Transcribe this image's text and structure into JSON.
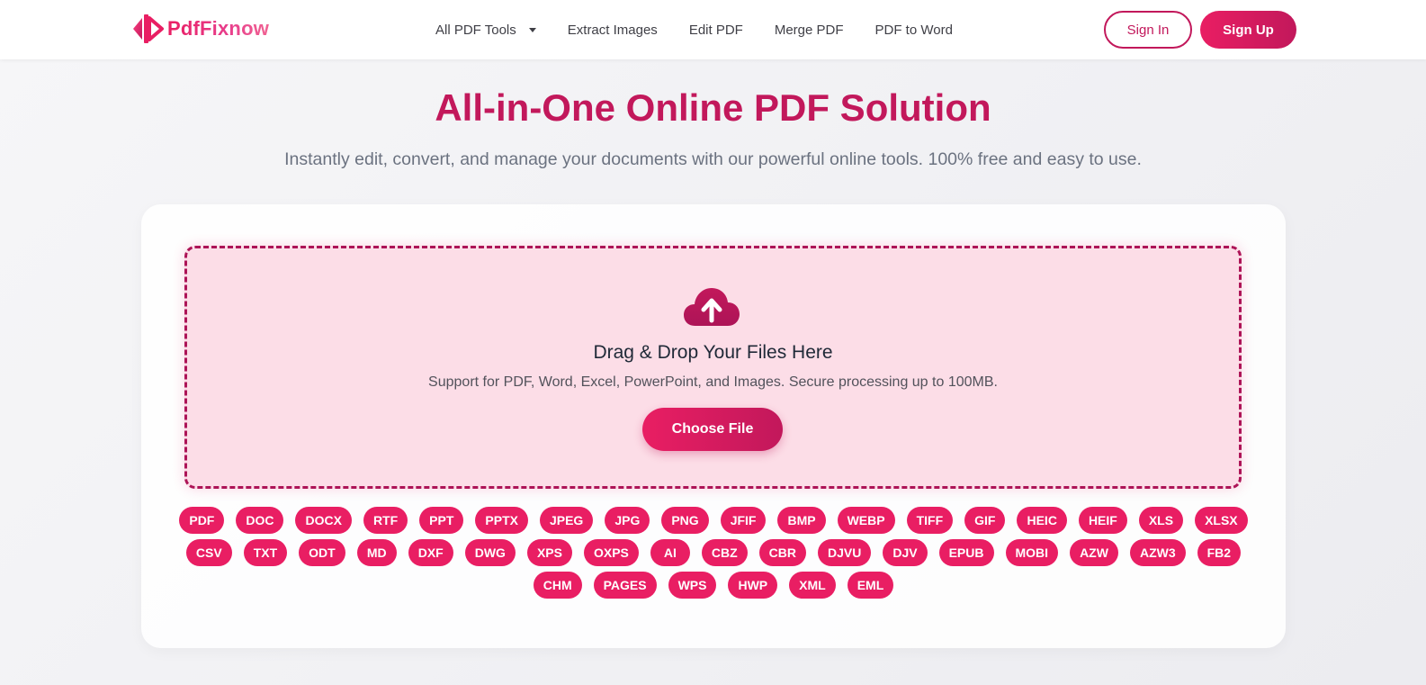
{
  "brand": {
    "name": "PdfFixnow"
  },
  "nav": {
    "items": [
      {
        "label": "All PDF Tools",
        "has_dropdown": true
      },
      {
        "label": "Extract Images"
      },
      {
        "label": "Edit PDF"
      },
      {
        "label": "Merge PDF"
      },
      {
        "label": "PDF to Word"
      }
    ]
  },
  "auth": {
    "sign_in": "Sign In",
    "sign_up": "Sign Up"
  },
  "hero": {
    "title": "All-in-One Online PDF Solution",
    "subtitle": "Instantly edit, convert, and manage your documents with our powerful online tools. 100% free and easy to use."
  },
  "dropzone": {
    "icon": "cloud-upload-icon",
    "title": "Drag & Drop Your Files Here",
    "subtitle": "Support for PDF, Word, Excel, PowerPoint, and Images. Secure processing up to 100MB.",
    "button": "Choose File"
  },
  "formats": {
    "rows": [
      [
        "PDF",
        "DOC",
        "DOCX",
        "RTF",
        "PPT",
        "PPTX",
        "JPEG",
        "JPG",
        "PNG",
        "JFIF",
        "BMP",
        "WEBP",
        "TIFF",
        "GIF",
        "HEIC",
        "HEIF",
        "XLS",
        "XLSX"
      ],
      [
        "CSV",
        "TXT",
        "ODT",
        "MD",
        "DXF",
        "DWG",
        "XPS",
        "OXPS",
        "AI",
        "CBZ",
        "CBR",
        "DJVU",
        "DJV",
        "EPUB",
        "MOBI",
        "AZW",
        "AZW3",
        "FB2"
      ],
      [
        "CHM",
        "PAGES",
        "WPS",
        "HWP",
        "XML",
        "EML"
      ]
    ]
  },
  "colors": {
    "accent": "#e91e63",
    "accent_dark": "#c2185b",
    "dropzone_bg": "#fcdde7"
  }
}
